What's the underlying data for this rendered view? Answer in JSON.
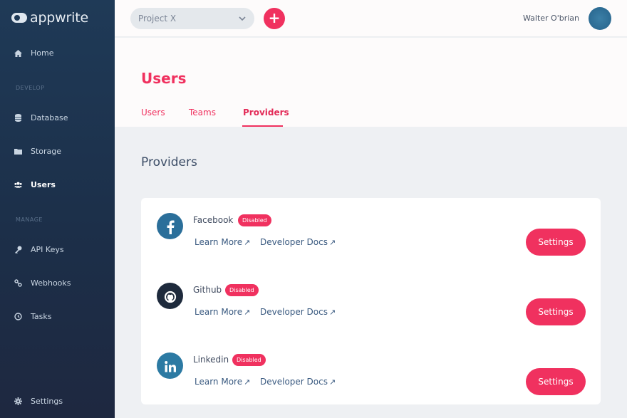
{
  "app": {
    "logo_text": "appwrite"
  },
  "sidebar": {
    "items": [
      {
        "label": "Home",
        "icon": "home-icon"
      },
      {
        "label": "Database",
        "icon": "database-icon"
      },
      {
        "label": "Storage",
        "icon": "folder-icon"
      },
      {
        "label": "Users",
        "icon": "users-icon"
      },
      {
        "label": "API Keys",
        "icon": "key-icon"
      },
      {
        "label": "Webhooks",
        "icon": "webhook-icon"
      },
      {
        "label": "Tasks",
        "icon": "clock-icon"
      },
      {
        "label": "Settings",
        "icon": "gear-icon"
      }
    ],
    "sections": {
      "develop": "DEVELOP",
      "manage": "MANAGE"
    }
  },
  "topbar": {
    "project": "Project X",
    "add_label": "+",
    "user_name": "Walter O'brian"
  },
  "header": {
    "title": "Users",
    "tabs": [
      {
        "label": "Users"
      },
      {
        "label": "Teams"
      },
      {
        "label": "Providers"
      }
    ]
  },
  "content": {
    "section_title": "Providers",
    "providers": [
      {
        "name": "Facebook",
        "status": "Disabled",
        "learn_more": "Learn More",
        "dev_docs": "Developer Docs",
        "settings": "Settings",
        "color": "#2b6f9a"
      },
      {
        "name": "Github",
        "status": "Disabled",
        "learn_more": "Learn More",
        "dev_docs": "Developer Docs",
        "settings": "Settings",
        "color": "#1e2a3c"
      },
      {
        "name": "Linkedin",
        "status": "Disabled",
        "learn_more": "Learn More",
        "dev_docs": "Developer Docs",
        "settings": "Settings",
        "color": "#2c7aa3"
      }
    ]
  },
  "colors": {
    "accent": "#f0315f",
    "sidebar": "#1f3a57"
  }
}
